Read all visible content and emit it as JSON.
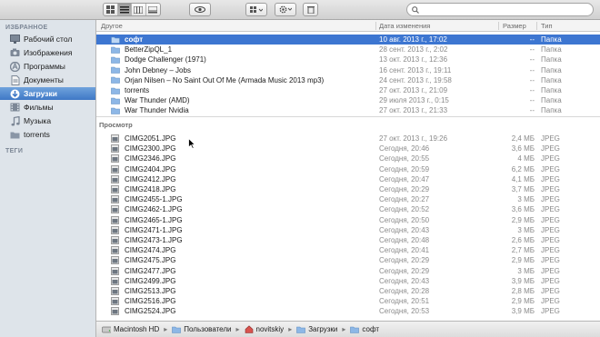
{
  "toolbar": {
    "view_buttons": [
      {
        "icon": "icon-view-icon",
        "active": false
      },
      {
        "icon": "list-view-icon",
        "active": true
      },
      {
        "icon": "column-view-icon",
        "active": false
      },
      {
        "icon": "cover-flow-view-icon",
        "active": false
      }
    ],
    "quicklook_icon": "eye-icon",
    "arrange_icon": "arrange-icon",
    "action_icon": "gear-icon",
    "trash_icon": "trash-icon",
    "search": {
      "placeholder": "",
      "value": ""
    }
  },
  "sidebar": {
    "favorites_header": "ИЗБРАННОЕ",
    "items": [
      {
        "label": "Рабочий стол",
        "icon": "desktop-icon",
        "selected": false
      },
      {
        "label": "Изображения",
        "icon": "camera-icon",
        "selected": false
      },
      {
        "label": "Программы",
        "icon": "apps-icon",
        "selected": false
      },
      {
        "label": "Документы",
        "icon": "document-icon",
        "selected": false
      },
      {
        "label": "Загрузки",
        "icon": "downloads-icon",
        "selected": true
      },
      {
        "label": "Фильмы",
        "icon": "film-icon",
        "selected": false
      },
      {
        "label": "Музыка",
        "icon": "music-icon",
        "selected": false
      },
      {
        "label": "torrents",
        "icon": "folder-icon",
        "selected": false
      }
    ],
    "tags_header": "ТЕГИ"
  },
  "columns": {
    "name": "Другое",
    "date": "Дата изменения",
    "size": "Размер",
    "kind": "Тип"
  },
  "groups": [
    {
      "label": "",
      "rows": [
        {
          "name": "софт",
          "date": "10 авг. 2013 г., 17:02",
          "size": "--",
          "kind": "Папка",
          "type": "folder",
          "selected": true
        },
        {
          "name": "BetterZipQL_1",
          "date": "28 сент. 2013 г., 2:02",
          "size": "--",
          "kind": "Папка",
          "type": "folder"
        },
        {
          "name": "Dodge Challenger (1971)",
          "date": "13 окт. 2013 г., 12:36",
          "size": "--",
          "kind": "Папка",
          "type": "folder"
        },
        {
          "name": "John Debney – Jobs",
          "date": "16 сент. 2013 г., 19:11",
          "size": "--",
          "kind": "Папка",
          "type": "folder"
        },
        {
          "name": "Orjan Nilsen – No Saint Out Of Me (Armada Music 2013 mp3)",
          "date": "24 сент. 2013 г., 19:58",
          "size": "--",
          "kind": "Папка",
          "type": "folder"
        },
        {
          "name": "torrents",
          "date": "27 окт. 2013 г., 21:09",
          "size": "--",
          "kind": "Папка",
          "type": "folder"
        },
        {
          "name": "War Thunder (AMD)",
          "date": "29 июля 2013 г., 0:15",
          "size": "--",
          "kind": "Папка",
          "type": "folder"
        },
        {
          "name": "War Thunder Nvidia",
          "date": "27 окт. 2013 г., 21:33",
          "size": "--",
          "kind": "Папка",
          "type": "folder"
        }
      ]
    },
    {
      "label": "Просмотр",
      "rows": [
        {
          "name": "CIMG2051.JPG",
          "date": "27 окт. 2013 г., 19:26",
          "size": "2,4 МБ",
          "kind": "JPEG",
          "type": "image"
        },
        {
          "name": "CIMG2300.JPG",
          "date": "Сегодня, 20:46",
          "size": "3,6 МБ",
          "kind": "JPEG",
          "type": "image"
        },
        {
          "name": "CIMG2346.JPG",
          "date": "Сегодня, 20:55",
          "size": "4 МБ",
          "kind": "JPEG",
          "type": "image"
        },
        {
          "name": "CIMG2404.JPG",
          "date": "Сегодня, 20:59",
          "size": "6,2 МБ",
          "kind": "JPEG",
          "type": "image"
        },
        {
          "name": "CIMG2412.JPG",
          "date": "Сегодня, 20:47",
          "size": "4,1 МБ",
          "kind": "JPEG",
          "type": "image"
        },
        {
          "name": "CIMG2418.JPG",
          "date": "Сегодня, 20:29",
          "size": "3,7 МБ",
          "kind": "JPEG",
          "type": "image"
        },
        {
          "name": "CIMG2455-1.JPG",
          "date": "Сегодня, 20:27",
          "size": "3 МБ",
          "kind": "JPEG",
          "type": "image"
        },
        {
          "name": "CIMG2462-1.JPG",
          "date": "Сегодня, 20:52",
          "size": "3,6 МБ",
          "kind": "JPEG",
          "type": "image"
        },
        {
          "name": "CIMG2465-1.JPG",
          "date": "Сегодня, 20:50",
          "size": "2,9 МБ",
          "kind": "JPEG",
          "type": "image"
        },
        {
          "name": "CIMG2471-1.JPG",
          "date": "Сегодня, 20:43",
          "size": "3 МБ",
          "kind": "JPEG",
          "type": "image"
        },
        {
          "name": "CIMG2473-1.JPG",
          "date": "Сегодня, 20:48",
          "size": "2,6 МБ",
          "kind": "JPEG",
          "type": "image"
        },
        {
          "name": "CIMG2474.JPG",
          "date": "Сегодня, 20:41",
          "size": "2,7 МБ",
          "kind": "JPEG",
          "type": "image"
        },
        {
          "name": "CIMG2475.JPG",
          "date": "Сегодня, 20:29",
          "size": "2,9 МБ",
          "kind": "JPEG",
          "type": "image"
        },
        {
          "name": "CIMG2477.JPG",
          "date": "Сегодня, 20:29",
          "size": "3 МБ",
          "kind": "JPEG",
          "type": "image"
        },
        {
          "name": "CIMG2499.JPG",
          "date": "Сегодня, 20:43",
          "size": "3,9 МБ",
          "kind": "JPEG",
          "type": "image"
        },
        {
          "name": "CIMG2513.JPG",
          "date": "Сегодня, 20:28",
          "size": "2,8 МБ",
          "kind": "JPEG",
          "type": "image"
        },
        {
          "name": "CIMG2516.JPG",
          "date": "Сегодня, 20:51",
          "size": "2,9 МБ",
          "kind": "JPEG",
          "type": "image"
        },
        {
          "name": "CIMG2524.JPG",
          "date": "Сегодня, 20:53",
          "size": "3,9 МБ",
          "kind": "JPEG",
          "type": "image"
        }
      ]
    }
  ],
  "pathbar": {
    "crumbs": [
      {
        "label": "Macintosh HD",
        "icon": "hard-drive-icon"
      },
      {
        "label": "Пользователи",
        "icon": "folder-icon"
      },
      {
        "label": "novitskiy",
        "icon": "home-icon"
      },
      {
        "label": "Загрузки",
        "icon": "folder-icon"
      },
      {
        "label": "софт",
        "icon": "folder-icon"
      }
    ]
  },
  "colors": {
    "selection": "#3d76d1",
    "sidebar_bg": "#dee4ea",
    "sidebar_selected": "#4a82cf"
  }
}
